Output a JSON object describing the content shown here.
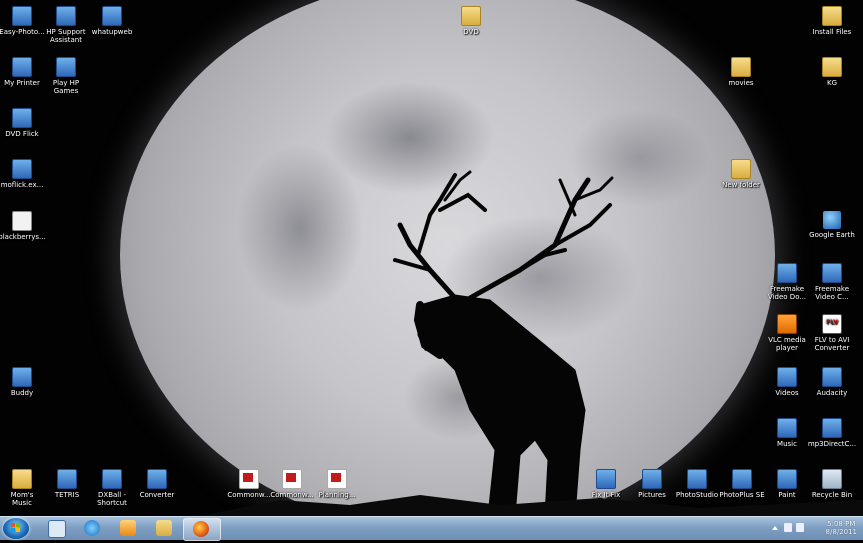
{
  "desktop": {
    "icons_left": [
      {
        "label": "Easy-Photo...",
        "icon": "app-icon"
      },
      {
        "label": "My Printer",
        "icon": "printer-icon"
      },
      {
        "label": "DVD Flick",
        "icon": "dvd-icon"
      },
      {
        "label": "moflick.ex...",
        "icon": "app-icon"
      },
      {
        "label": "blackberrys...",
        "icon": "document-icon"
      },
      {
        "label": "Buddy",
        "icon": "app-icon"
      }
    ],
    "icons_col2": [
      {
        "label": "HP Support\nAssistant",
        "icon": "hp-icon"
      },
      {
        "label": "Play HP\nGames",
        "icon": "games-icon"
      }
    ],
    "icons_col3": [
      {
        "label": "whatupweb",
        "icon": "windows-icon"
      }
    ],
    "top_folders": [
      {
        "label": "DVD",
        "icon": "folder-icon"
      },
      {
        "label": "movies",
        "icon": "folder-icon"
      },
      {
        "label": "New folder",
        "icon": "folder-icon"
      }
    ],
    "icons_right_col1": [
      {
        "label": "Freemake\nVideo Do...",
        "icon": "freemake-icon"
      },
      {
        "label": "VLC media\nplayer",
        "icon": "vlc-icon"
      },
      {
        "label": "Videos",
        "icon": "video-icon"
      },
      {
        "label": "Music",
        "icon": "music-icon"
      },
      {
        "label": "Paint",
        "icon": "paint-icon"
      }
    ],
    "icons_right_col2": [
      {
        "label": "Install Files",
        "icon": "folder-icon"
      },
      {
        "label": "KG",
        "icon": "folder-icon"
      },
      {
        "label": "Google Earth",
        "icon": "globe-icon"
      },
      {
        "label": "Freemake\nVideo C...",
        "icon": "freemake-icon"
      },
      {
        "label": "FLV to AVI\nConverter",
        "icon": "flv-icon"
      },
      {
        "label": "Audacity",
        "icon": "audacity-icon"
      },
      {
        "label": "mp3DirectC...",
        "icon": "app-icon"
      },
      {
        "label": "Recycle Bin",
        "icon": "recycle-bin-icon"
      }
    ],
    "bottom_row": [
      {
        "label": "Mom's\nMusic",
        "icon": "folder-icon"
      },
      {
        "label": "TETRIS",
        "icon": "app-icon"
      },
      {
        "label": "DXBall -\nShortcut",
        "icon": "app-icon"
      },
      {
        "label": "Converter",
        "icon": "app-icon"
      },
      {
        "label": "Commonw...",
        "icon": "pdf-icon"
      },
      {
        "label": "Commonw...",
        "icon": "pdf-icon"
      },
      {
        "label": "Planning...",
        "icon": "pdf-icon"
      },
      {
        "label": "Fix It Fix",
        "icon": "app-icon"
      },
      {
        "label": "Pictures",
        "icon": "pictures-icon"
      },
      {
        "label": "PhotoStudio",
        "icon": "app-icon"
      },
      {
        "label": "PhotoPlus SE",
        "icon": "app-icon"
      }
    ]
  },
  "taskbar": {
    "pinned": [
      {
        "name": "tb-network-app",
        "icon": "network-icon"
      },
      {
        "name": "tb-internet-explorer",
        "icon": "internet-explorer-icon"
      },
      {
        "name": "tb-media-player",
        "icon": "media-player-icon"
      },
      {
        "name": "tb-explorer",
        "icon": "folder-icon"
      },
      {
        "name": "tb-firefox",
        "icon": "firefox-icon"
      }
    ],
    "clock_time": "5:08 PM",
    "clock_date": "8/8/2011"
  },
  "colors": {
    "taskbar": "#7f9fc2",
    "desktop": "#020202"
  }
}
